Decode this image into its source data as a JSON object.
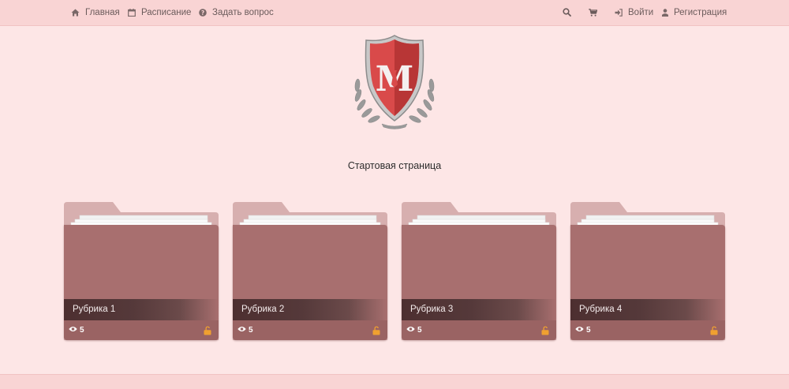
{
  "nav": {
    "home_label": "Главная",
    "schedule_label": "Расписание",
    "ask_label": "Задать вопрос",
    "login_label": "Войти",
    "register_label": "Регистрация",
    "icons": [
      "home-icon",
      "calendar-icon",
      "question-icon",
      "search-icon",
      "cart-icon",
      "login-icon",
      "user-icon"
    ]
  },
  "logo": {
    "letter": "M"
  },
  "page": {
    "title": "Стартовая страница"
  },
  "categories": [
    {
      "label": "Рубрика 1",
      "views": "5"
    },
    {
      "label": "Рубрика 2",
      "views": "5"
    },
    {
      "label": "Рубрика 3",
      "views": "5"
    },
    {
      "label": "Рубрика 4",
      "views": "5"
    }
  ],
  "colors": {
    "background": "#fde6e6",
    "topbar": "#f9d4d4",
    "folder": "#a86f6f",
    "caption": "#4d2f30",
    "lock": "#f0a030",
    "shield": "#d94a4a"
  }
}
